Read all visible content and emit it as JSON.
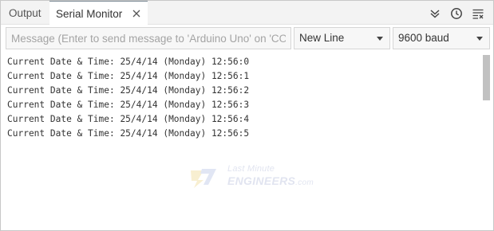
{
  "tabs": {
    "output_label": "Output",
    "serial_label": "Serial Monitor"
  },
  "toolbar": {
    "icons": [
      "collapse-down-icon",
      "clock-icon",
      "clear-output-icon"
    ]
  },
  "message_input": {
    "placeholder": "Message (Enter to send message to 'Arduino Uno' on 'COM...",
    "value": ""
  },
  "line_ending": {
    "selected": "New Line"
  },
  "baud_rate": {
    "selected": "9600 baud"
  },
  "output_lines": [
    "Current Date & Time: 25/4/14 (Monday) 12:56:0",
    "Current Date & Time: 25/4/14 (Monday) 12:56:1",
    "Current Date & Time: 25/4/14 (Monday) 12:56:2",
    "Current Date & Time: 25/4/14 (Monday) 12:56:3",
    "Current Date & Time: 25/4/14 (Monday) 12:56:4",
    "Current Date & Time: 25/4/14 (Monday) 12:56:5"
  ],
  "watermark": {
    "line1": "Last Minute",
    "line2": "ENGINEERS",
    "line2_suffix": ".com"
  },
  "colors": {
    "tab_bar_bg": "#f3f3f3",
    "text": "#333333",
    "placeholder": "#a4a4a4",
    "scrollbar": "#c1c1c1"
  }
}
